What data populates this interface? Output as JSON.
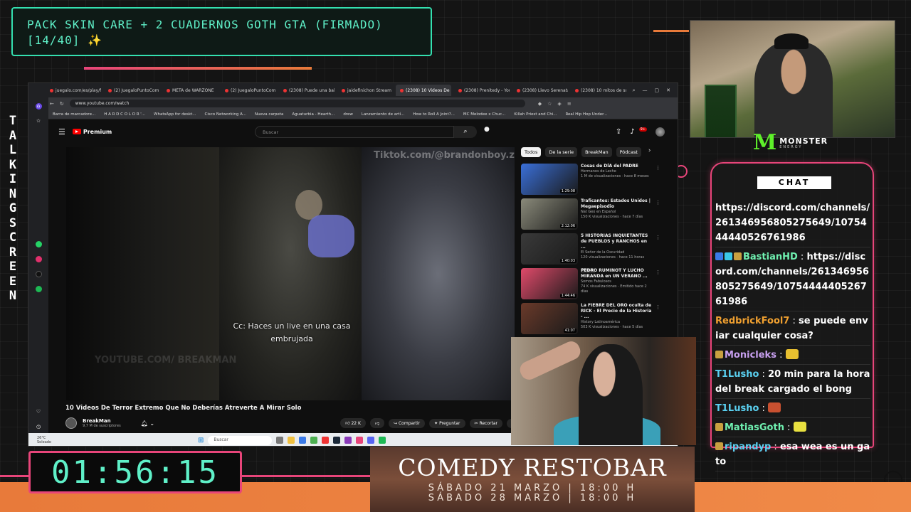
{
  "title_box": {
    "line1": "PACK SKIN CARE + 2 CUADERNOS GOTH GTA (FIRMADO)",
    "line2": "[14/40] ✨"
  },
  "vertical_label": "TALKING SCREEN",
  "browser": {
    "tabs": [
      {
        "label": "juegalo.com/es/play/fr",
        "active": false
      },
      {
        "label": "(2) JuegaloPuntoCom",
        "active": false
      },
      {
        "label": "META de WARZONE",
        "active": false
      },
      {
        "label": "(2) JuegaloPuntoCom",
        "active": false
      },
      {
        "label": "(2308) Puede una bala",
        "active": false
      },
      {
        "label": "jaidefinichon Stream",
        "active": false
      },
      {
        "label": "(2308) 10 Videos De",
        "active": true
      },
      {
        "label": "(2308) Prenitedy - YouT",
        "active": false
      },
      {
        "label": "(2308) Llevo Serenata",
        "active": false
      },
      {
        "label": "(2308) 10 mitos de sup",
        "active": false
      }
    ],
    "url": "www.youtube.com/watch",
    "bookmarks": [
      "Barra de marcadore...",
      "H A R D C O L O R '...",
      "WhatsApp for deskt...",
      "Cisco Networking A...",
      "Nueva carpeta",
      "Aguaturbia - Hearth...",
      "drew",
      "Lanzamiento de artí...",
      "How to Roll A Joint?...",
      "MC Melodee x Chuc...",
      "Killah Priest and Chi...",
      "Real Hip Hop Under..."
    ]
  },
  "youtube": {
    "logo": "Premium",
    "search_placeholder": "Buscar",
    "notif_count": "9+",
    "video": {
      "watermark": "Tiktok.com/@brandonboy.z",
      "watermark_left": "YOUTUBE.COM/ BREAKMAN",
      "caption": "Cc: Haces un live en una casa embrujada",
      "title": "10 Videos De Terror Extremo Que No Deberías Atreverte A Mirar Solo",
      "channel": "BreakMan",
      "subs": "9,7 M de suscriptores",
      "likes": "22 K",
      "share": "Compartir",
      "ask": "Preguntar",
      "clip": "Recortar"
    },
    "chips": [
      "Todos",
      "De la serie",
      "BreakMan",
      "Pódcast"
    ],
    "recommendations": [
      {
        "title": "Cosas de DÍA del PADRE",
        "channel": "Hermanos de Leche",
        "meta": "1 M de visualizaciones · hace 8 meses",
        "duration": "1:29:08",
        "thumb": "#3a6fd8"
      },
      {
        "title": "Traficantes: Estados Unidos | Megaepisodio",
        "channel": "Nat Geo en Español",
        "meta": "150 K visualizaciones · hace 7 días",
        "duration": "2:12:06",
        "thumb": "#8a8a7a"
      },
      {
        "title": "5 HISTORIAS INQUIETANTES de PUEBLOS y RANCHOS en ...",
        "channel": "El Señor de la Oscuridad",
        "meta": "120 visualizaciones · hace 11 horas",
        "duration": "1:40:03",
        "badge": "Nuevo",
        "thumb": "#3a3a3a"
      },
      {
        "title": "PEDRO RUMINOT Y LUCHO MIRANDA en UN VERANO ...",
        "channel": "Somos Fabulosos",
        "meta": "74 K visualizaciones · Emitido hace 2 días",
        "duration": "1:44:46",
        "thumb": "#e04a6a"
      },
      {
        "title": "La FIEBRE DEL ORO oculta de RICK - El Precio de la Historia - ...",
        "channel": "History Latinoamérica",
        "meta": "503 K visualizaciones · hace 5 días",
        "duration": "41:07",
        "badge": "Nuevo",
        "thumb": "#6a3a2a"
      }
    ]
  },
  "taskbar": {
    "temp": "26°C",
    "condition": "Soleado",
    "search": "Buscar"
  },
  "monster": {
    "brand": "MONSTER",
    "sub": "ENERGY"
  },
  "chat": {
    "header": "CHAT",
    "messages": [
      {
        "user": "",
        "text": "https://discord.com/channels/261346956805275649/1075444440526761986",
        "user_color": "#fff",
        "badges": []
      },
      {
        "user": "BastianHD",
        "text": "https://discord.com/channels/261346956805275649/1075444440526761986",
        "user_color": "#6ff0b0",
        "badges": [
          "#3a7ae8",
          "#3ac8e8",
          "#c8a040"
        ]
      },
      {
        "user": "RedbrickFool7",
        "text": "se puede enviar cualquier cosa?",
        "user_color": "#f0a030",
        "badges": []
      },
      {
        "user": "Monicleks",
        "text": "",
        "user_color": "#c8a0f0",
        "badges": [
          "#c8a040"
        ],
        "emote": "#e8c030"
      },
      {
        "user": "T1Lusho",
        "text": "20 min para la hora del break cargado el bong",
        "user_color": "#5ad0f0",
        "badges": []
      },
      {
        "user": "T1Lusho",
        "text": "",
        "user_color": "#5ad0f0",
        "badges": [],
        "emote": "#c85030"
      },
      {
        "user": "MatiasGoth",
        "text": "",
        "user_color": "#6ff0b0",
        "badges": [
          "#c8a040"
        ],
        "emote": "#e8e040"
      },
      {
        "user": "ripandyp",
        "text": "esa wea es un gato",
        "user_color": "#5ad0f0",
        "badges": [
          "#c8a040"
        ]
      }
    ]
  },
  "timer": "01:56:15",
  "comedy": {
    "title": "COMEDY RESTOBAR",
    "date1": "SÁBADO 21 MARZO | 18:00 H",
    "date2": "SÁBADO 28 MARZO | 18:00 H"
  },
  "colors": {
    "accent_teal": "#5ff0c8",
    "accent_pink": "#e8457a",
    "accent_orange": "#e87a3a"
  }
}
